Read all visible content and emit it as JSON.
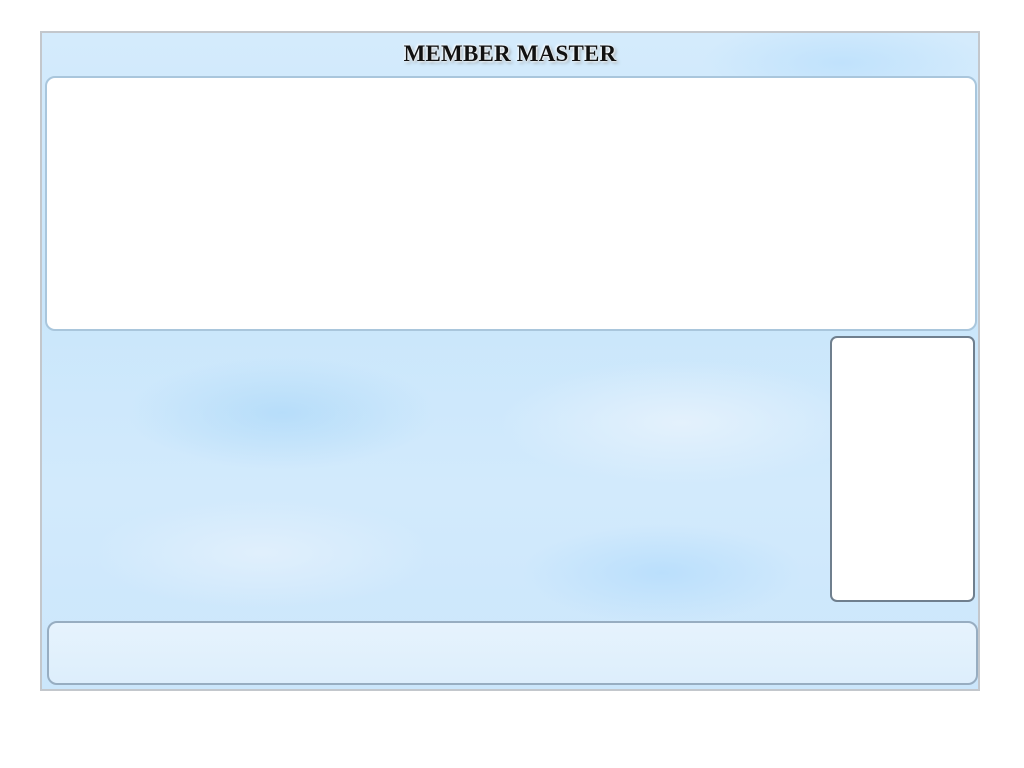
{
  "window": {
    "title": "MEMBER MASTER"
  },
  "colors": {
    "background_sky": "#c9e6fb",
    "panel_white": "#ffffff",
    "top_panel_border": "#a9c6dc",
    "side_panel_border": "#6f7f8e",
    "bottom_bar_border": "#97adc1",
    "window_border": "#c3c7cc"
  }
}
